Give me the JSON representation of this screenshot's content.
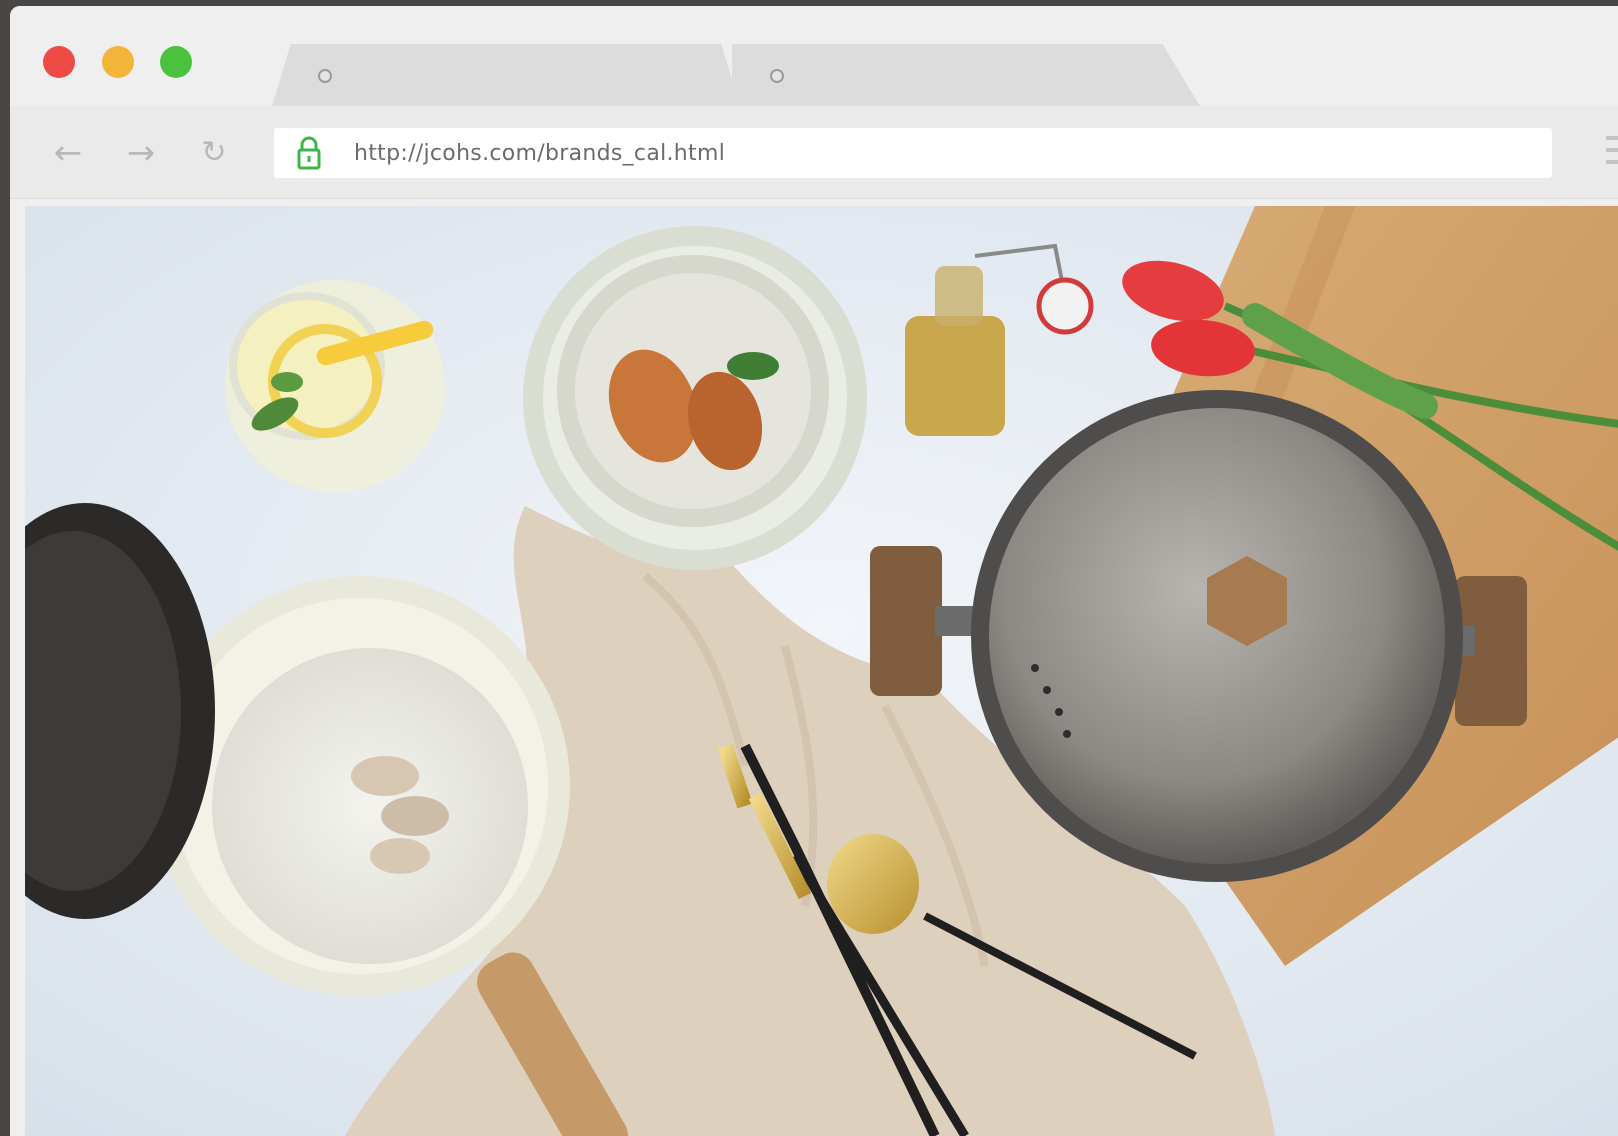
{
  "window": {
    "controls": [
      "close",
      "minimize",
      "maximize"
    ],
    "tabs": [
      {
        "label": ""
      },
      {
        "label": ""
      }
    ]
  },
  "toolbar": {
    "back_icon": "arrow-left",
    "forward_icon": "arrow-right",
    "reload_icon": "reload",
    "lock_icon": "lock",
    "url": "http://jcohs.com/brands_cal.html",
    "menu_icon": "hamburger-menu"
  },
  "colors": {
    "close": "#ed4a45",
    "minimize": "#f3b539",
    "maximize": "#4bc23e",
    "lock": "#3fb64a"
  },
  "content": {
    "image": "tabletop-cookware-photo"
  }
}
